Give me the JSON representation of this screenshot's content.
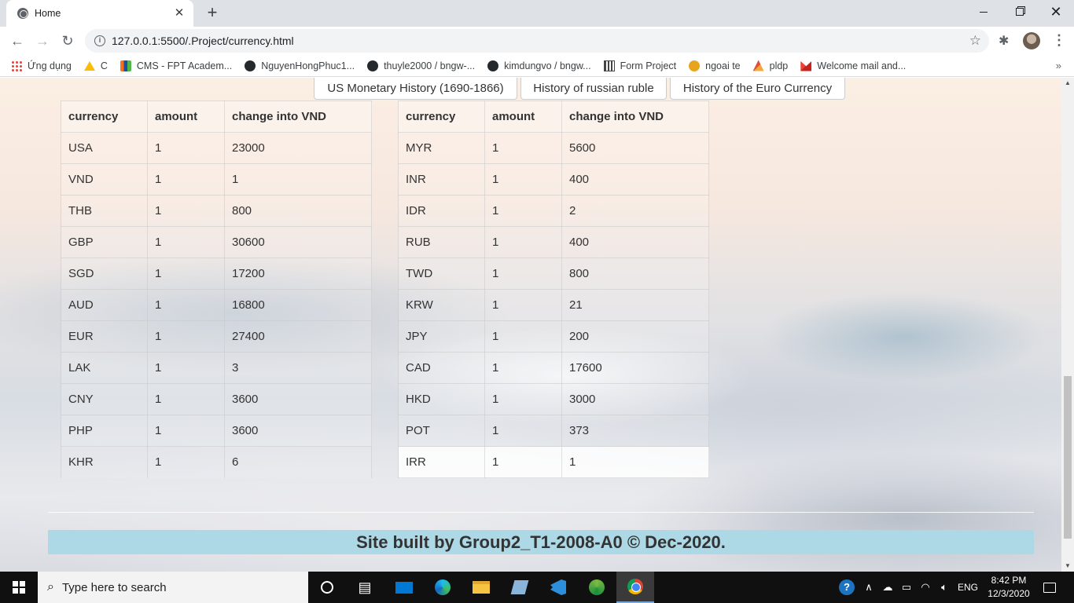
{
  "browser": {
    "tab_title": "Home",
    "url": "127.0.0.1:5500/.Project/currency.html",
    "bookmarks": [
      {
        "label": "Ứng dụng",
        "icon": "apps-grid-icon"
      },
      {
        "label": "C",
        "icon": "google-drive-icon"
      },
      {
        "label": "CMS - FPT Academ...",
        "icon": "fpt-icon"
      },
      {
        "label": "NguyenHongPhuc1...",
        "icon": "github-icon"
      },
      {
        "label": "thuyle2000 / bngw-...",
        "icon": "github-icon"
      },
      {
        "label": "kimdungvo / bngw...",
        "icon": "github-icon"
      },
      {
        "label": "Form Project",
        "icon": "calculator-icon"
      },
      {
        "label": "ngoai te",
        "icon": "ngoai-te-icon"
      },
      {
        "label": "pldp",
        "icon": "pldp-icon"
      },
      {
        "label": "Welcome mail and...",
        "icon": "gmail-icon"
      }
    ]
  },
  "page": {
    "history_buttons": [
      "US Monetary History (1690-1866)",
      "History of russian ruble",
      "History of the Euro Currency"
    ],
    "table_headers": [
      "currency",
      "amount",
      "change into VND"
    ],
    "left_table": [
      [
        "USA",
        "1",
        "23000"
      ],
      [
        "VND",
        "1",
        "1"
      ],
      [
        "THB",
        "1",
        "800"
      ],
      [
        "GBP",
        "1",
        "30600"
      ],
      [
        "SGD",
        "1",
        "17200"
      ],
      [
        "AUD",
        "1",
        "16800"
      ],
      [
        "EUR",
        "1",
        "27400"
      ],
      [
        "LAK",
        "1",
        "3"
      ],
      [
        "CNY",
        "1",
        "3600"
      ],
      [
        "PHP",
        "1",
        "3600"
      ],
      [
        "KHR",
        "1",
        "6"
      ]
    ],
    "right_table": [
      [
        "MYR",
        "1",
        "5600"
      ],
      [
        "INR",
        "1",
        "400"
      ],
      [
        "IDR",
        "1",
        "2"
      ],
      [
        "RUB",
        "1",
        "400"
      ],
      [
        "TWD",
        "1",
        "800"
      ],
      [
        "KRW",
        "1",
        "21"
      ],
      [
        "JPY",
        "1",
        "200"
      ],
      [
        "CAD",
        "1",
        "17600"
      ],
      [
        "HKD",
        "1",
        "3000"
      ],
      [
        "POT",
        "1",
        "373"
      ],
      [
        "IRR",
        "1",
        "1"
      ]
    ],
    "footer": "Site built by Group2_T1-2008-A0 © Dec-2020.",
    "footer_bg": "#add8e6"
  },
  "taskbar": {
    "search_placeholder": "Type here to search",
    "language": "ENG",
    "time": "8:42 PM",
    "date": "12/3/2020"
  }
}
